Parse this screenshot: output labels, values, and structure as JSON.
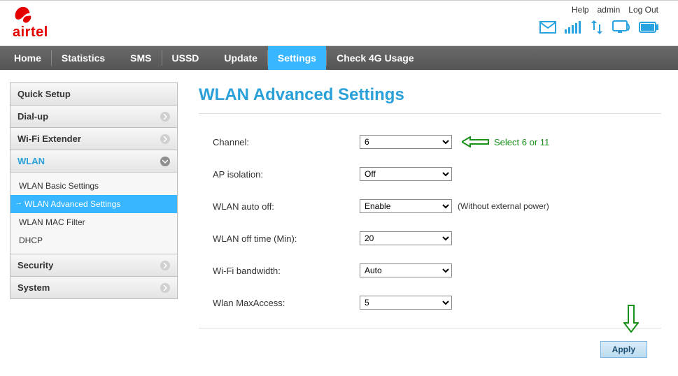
{
  "header": {
    "brand": "airtel",
    "links": {
      "help": "Help",
      "admin": "admin",
      "logout": "Log Out"
    }
  },
  "nav": {
    "home": "Home",
    "statistics": "Statistics",
    "sms": "SMS",
    "ussd": "USSD",
    "update": "Update",
    "settings": "Settings",
    "check4g": "Check 4G Usage"
  },
  "sidebar": {
    "quick_setup": "Quick Setup",
    "dial_up": "Dial-up",
    "wifi_ext": "Wi-Fi Extender",
    "wlan": {
      "label": "WLAN",
      "basic": "WLAN Basic Settings",
      "advanced": "WLAN Advanced Settings",
      "mac": "WLAN MAC Filter",
      "dhcp": "DHCP"
    },
    "security": "Security",
    "system": "System"
  },
  "page": {
    "title": "WLAN Advanced Settings",
    "rows": {
      "channel": {
        "label": "Channel:",
        "value": "6"
      },
      "ap": {
        "label": "AP isolation:",
        "value": "Off"
      },
      "autooff": {
        "label": "WLAN auto off:",
        "value": "Enable",
        "trail": "(Without external power)"
      },
      "offtime": {
        "label": "WLAN off time (Min):",
        "value": "20"
      },
      "bw": {
        "label": "Wi-Fi bandwidth:",
        "value": "Auto"
      },
      "maxaccess": {
        "label": "Wlan MaxAccess:",
        "value": "5"
      }
    },
    "apply": "Apply"
  },
  "annotations": {
    "channel_hint": "Select 6 or 11"
  }
}
